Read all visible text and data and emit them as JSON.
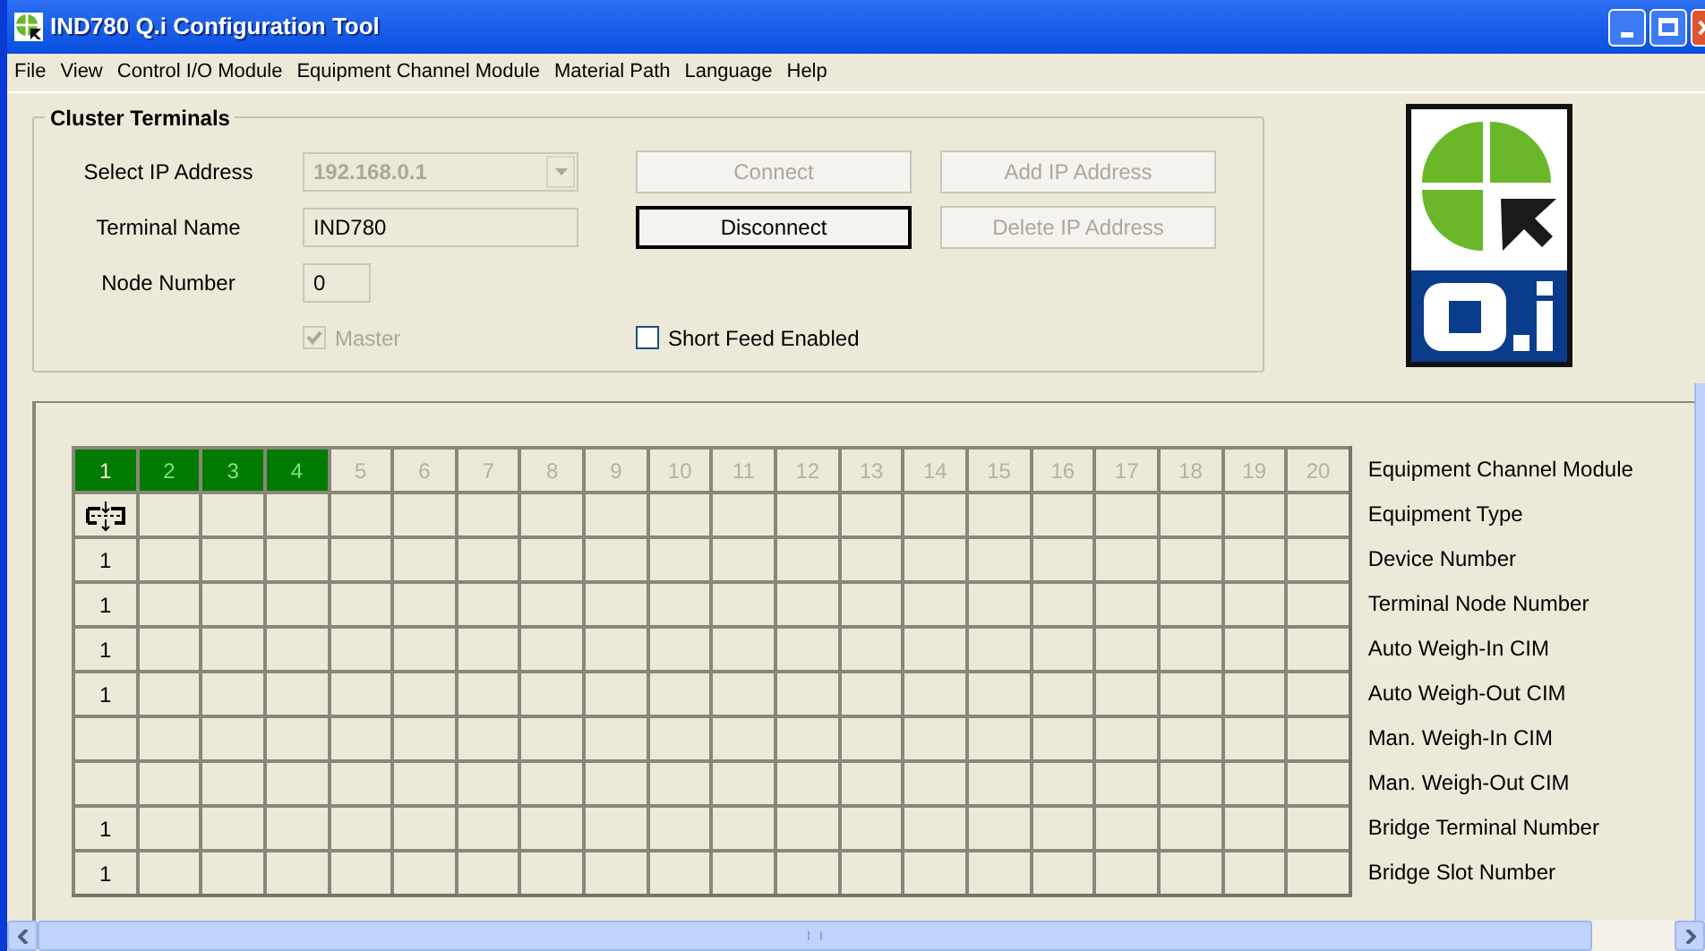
{
  "window": {
    "title": "IND780 Q.i Configuration Tool"
  },
  "menu": [
    "File",
    "View",
    "Control I/O Module",
    "Equipment Channel Module",
    "Material Path",
    "Language",
    "Help"
  ],
  "cluster_terminals": {
    "title": "Cluster Terminals",
    "ip_label": "Select IP Address",
    "ip_value": "192.168.0.1",
    "ip_disabled": true,
    "name_label": "Terminal Name",
    "name_value": "IND780",
    "node_label": "Node Number",
    "node_value": "0",
    "master": {
      "label": "Master",
      "checked": true,
      "disabled": true
    },
    "short_feed": {
      "label": "Short Feed Enabled",
      "checked": false,
      "disabled": false
    },
    "buttons": [
      {
        "label": "Connect",
        "disabled": true
      },
      {
        "label": "Add IP Address",
        "disabled": true
      },
      {
        "label": "Disconnect",
        "disabled": false
      },
      {
        "label": "Delete IP Address",
        "disabled": true
      }
    ]
  },
  "modules": [
    {
      "label": "1",
      "active": true,
      "selected": true
    },
    {
      "label": "2",
      "active": true,
      "selected": false
    },
    {
      "label": "3",
      "active": true,
      "selected": false
    },
    {
      "label": "4",
      "active": true,
      "selected": false
    },
    {
      "label": "5",
      "active": false,
      "selected": false
    },
    {
      "label": "6",
      "active": false,
      "selected": false
    },
    {
      "label": "7",
      "active": false,
      "selected": false
    },
    {
      "label": "8",
      "active": false,
      "selected": false
    },
    {
      "label": "9",
      "active": false,
      "selected": false
    },
    {
      "label": "10",
      "active": false,
      "selected": false
    },
    {
      "label": "11",
      "active": false,
      "selected": false
    },
    {
      "label": "12",
      "active": false,
      "selected": false
    },
    {
      "label": "13",
      "active": false,
      "selected": false
    },
    {
      "label": "14",
      "active": false,
      "selected": false
    },
    {
      "label": "15",
      "active": false,
      "selected": false
    },
    {
      "label": "16",
      "active": false,
      "selected": false
    },
    {
      "label": "17",
      "active": false,
      "selected": false
    },
    {
      "label": "18",
      "active": false,
      "selected": false
    },
    {
      "label": "19",
      "active": false,
      "selected": false
    },
    {
      "label": "20",
      "active": false,
      "selected": false
    }
  ],
  "header_label": "Equipment Channel Module",
  "rows": [
    {
      "label": "Equipment Type",
      "kind": "icon"
    },
    {
      "label": "Device Number",
      "kind": "text",
      "value": "1"
    },
    {
      "label": "Terminal Node Number",
      "kind": "text",
      "value": "1"
    },
    {
      "label": "Auto Weigh-In CIM",
      "kind": "text",
      "value": "1"
    },
    {
      "label": "Auto Weigh-Out CIM",
      "kind": "text",
      "value": "1"
    },
    {
      "label": "Man. Weigh-In CIM",
      "kind": "text"
    },
    {
      "label": "Man. Weigh-Out CIM",
      "kind": "text"
    },
    {
      "label": "Bridge Terminal Number",
      "kind": "text",
      "value": "1"
    },
    {
      "label": "Bridge Slot Number",
      "kind": "text",
      "value": "1"
    }
  ]
}
